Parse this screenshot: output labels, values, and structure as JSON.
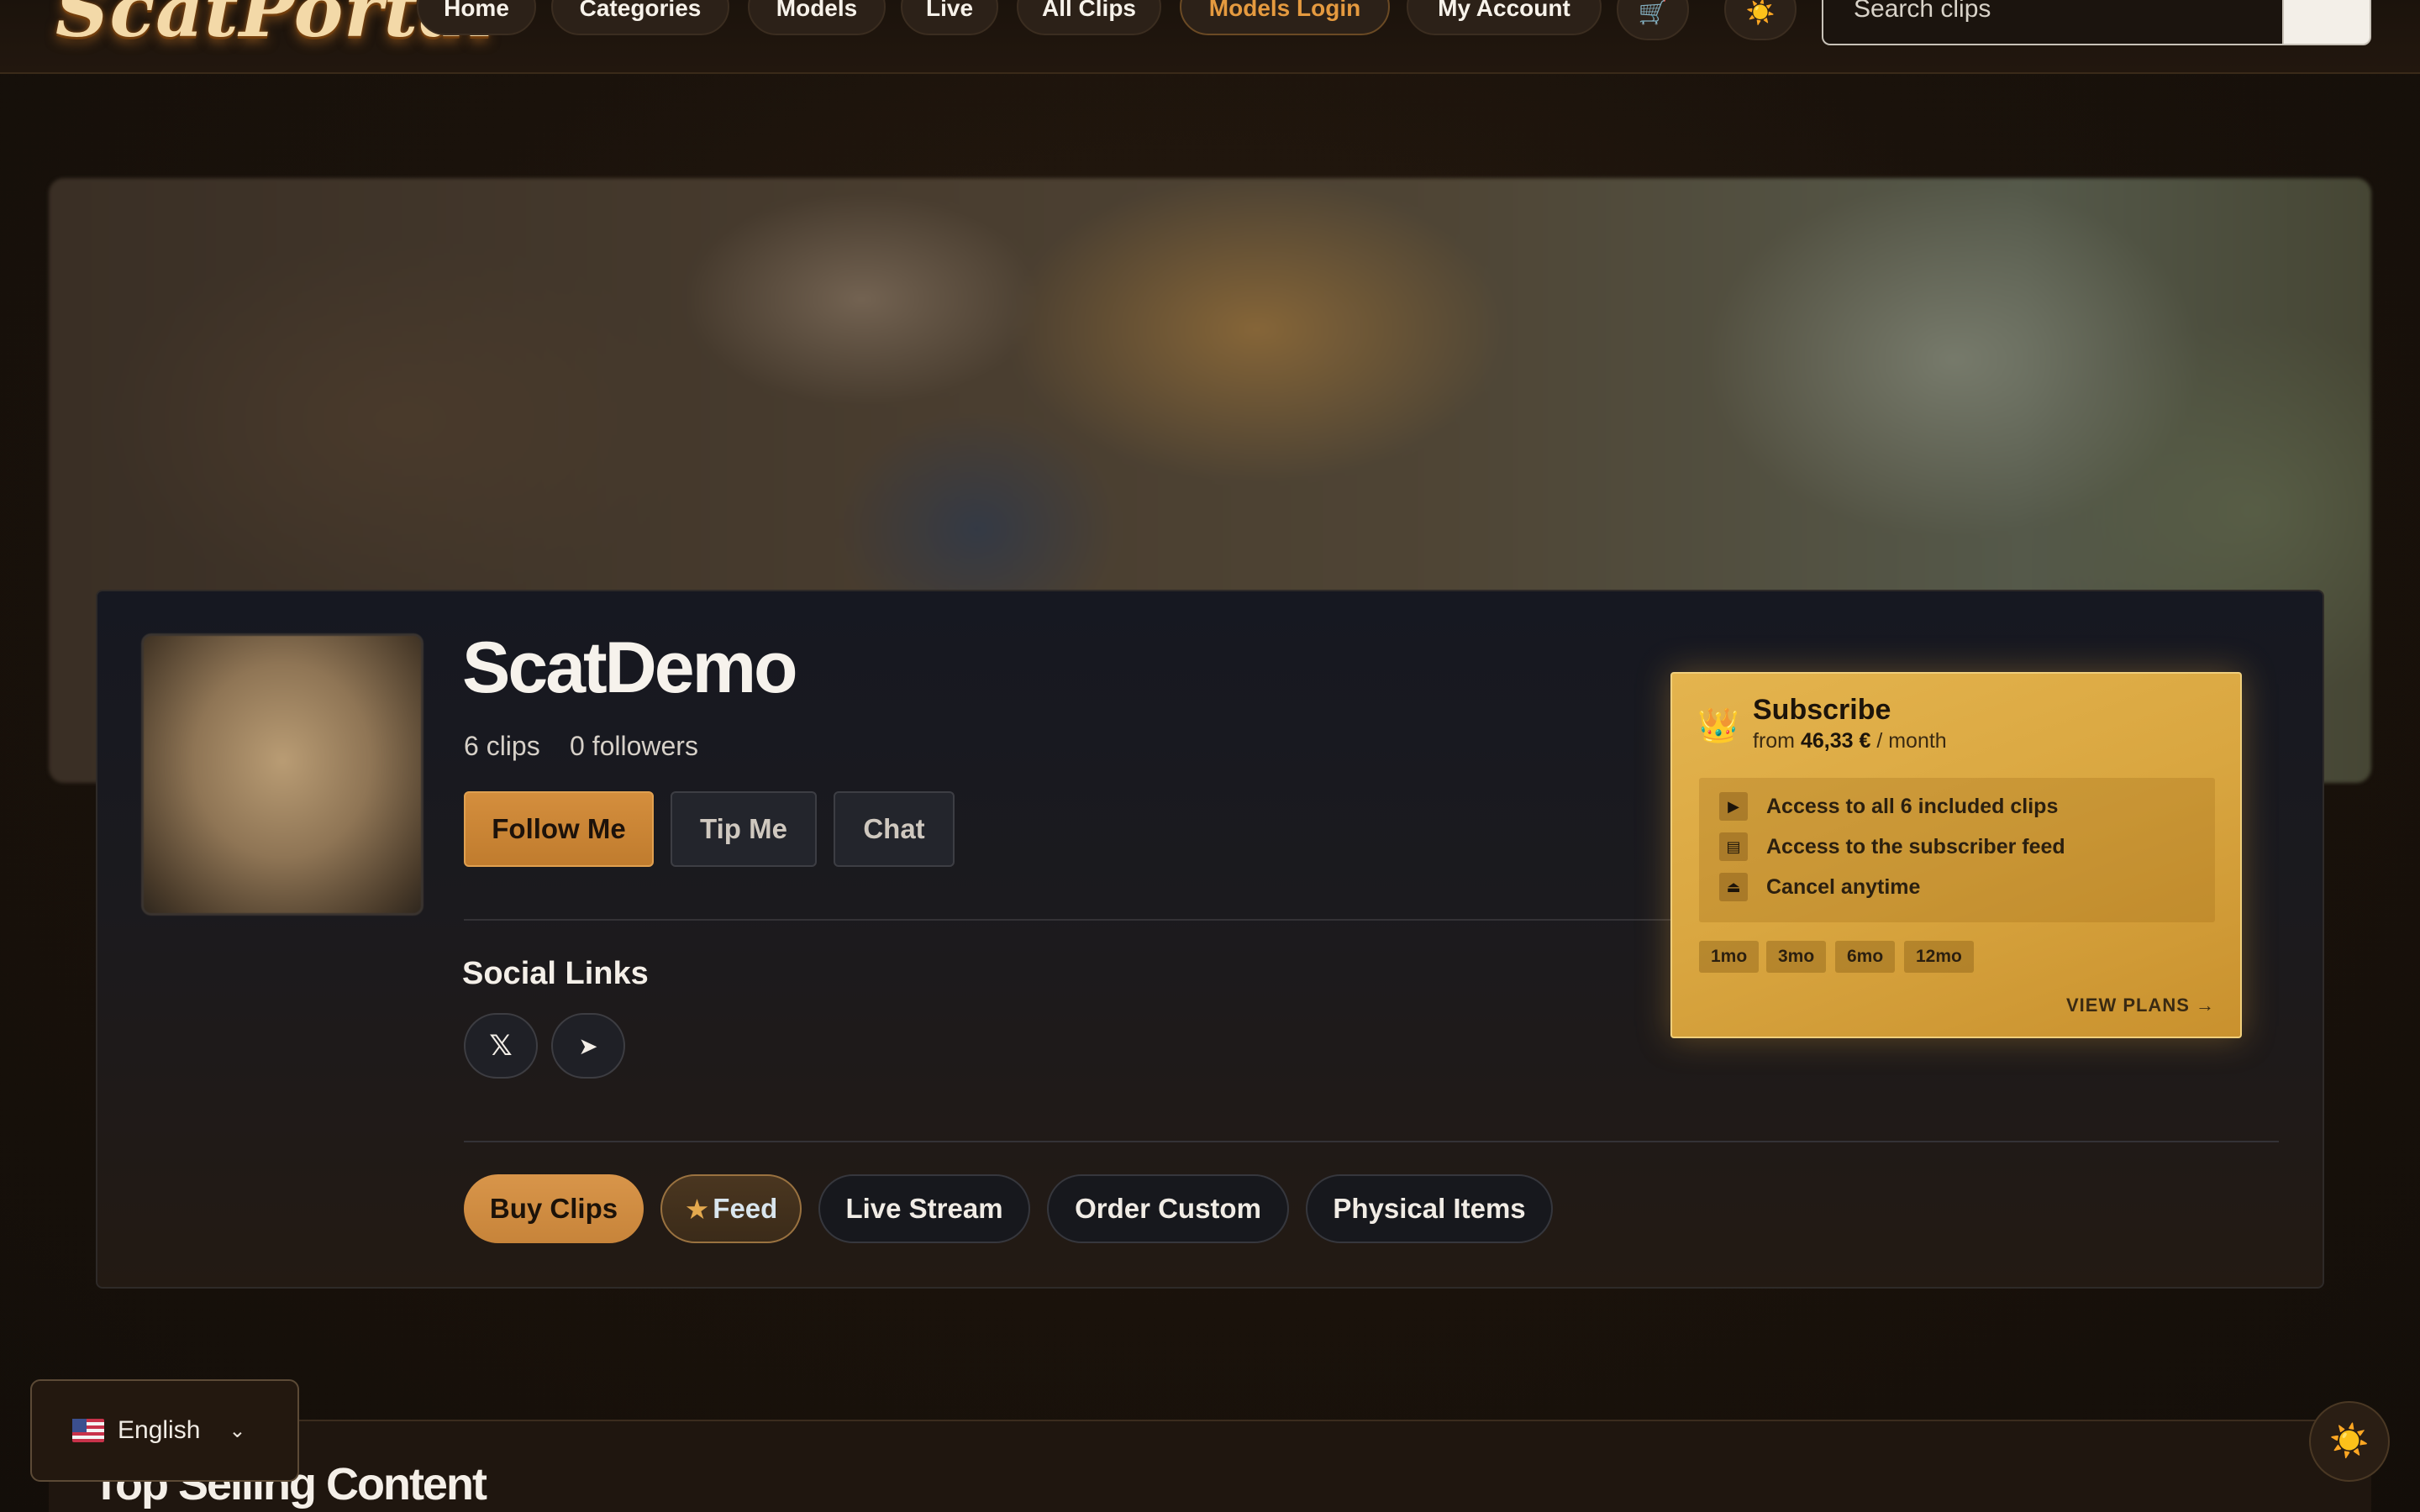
{
  "nav": {
    "logo": "ScatPortal",
    "items": [
      {
        "label": "Home"
      },
      {
        "label": "Categories"
      },
      {
        "label": "Models"
      },
      {
        "label": "Live"
      },
      {
        "label": "All Clips"
      },
      {
        "label": "Models Login"
      },
      {
        "label": "My Account"
      }
    ],
    "cart_icon": "🛒",
    "theme_icon": "☀️",
    "search_placeholder": "Search clips"
  },
  "profile": {
    "name": "ScatDemo",
    "clips": "6 clips",
    "followers": "0 followers",
    "actions": [
      {
        "label": "Follow Me"
      },
      {
        "label": "Tip Me"
      },
      {
        "label": "Chat"
      }
    ],
    "social_title": "Social Links",
    "social": [
      {
        "label": "𝕏",
        "icon": "x-icon"
      },
      {
        "label": "➤",
        "icon": "telegram-icon"
      }
    ]
  },
  "subscribe": {
    "crown_icon": "👑",
    "title": "Subscribe",
    "price_prefix": "from",
    "price": "46,33 €",
    "price_suffix": "/ month",
    "features": [
      {
        "icon": "▶",
        "text": "Access to all 6 included clips"
      },
      {
        "icon": "▤",
        "text": "Access to the subscriber feed"
      },
      {
        "icon": "⏏",
        "text": "Cancel anytime"
      }
    ],
    "plans": [
      "1mo",
      "3mo",
      "6mo",
      "12mo"
    ],
    "view_plans": "VIEW PLANS →"
  },
  "tabs": [
    {
      "label": "Buy Clips"
    },
    {
      "label": "Feed",
      "star": "★"
    },
    {
      "label": "Live Stream"
    },
    {
      "label": "Order Custom"
    },
    {
      "label": "Physical Items"
    }
  ],
  "section": {
    "title": "Top Selling Content"
  },
  "language": {
    "selected": "English",
    "chevron": "⌄"
  },
  "theme_fab_icon": "☀️",
  "colors": {
    "accent": "#d48e3d",
    "gold": "#e4b44e",
    "background": "#1a120b"
  }
}
